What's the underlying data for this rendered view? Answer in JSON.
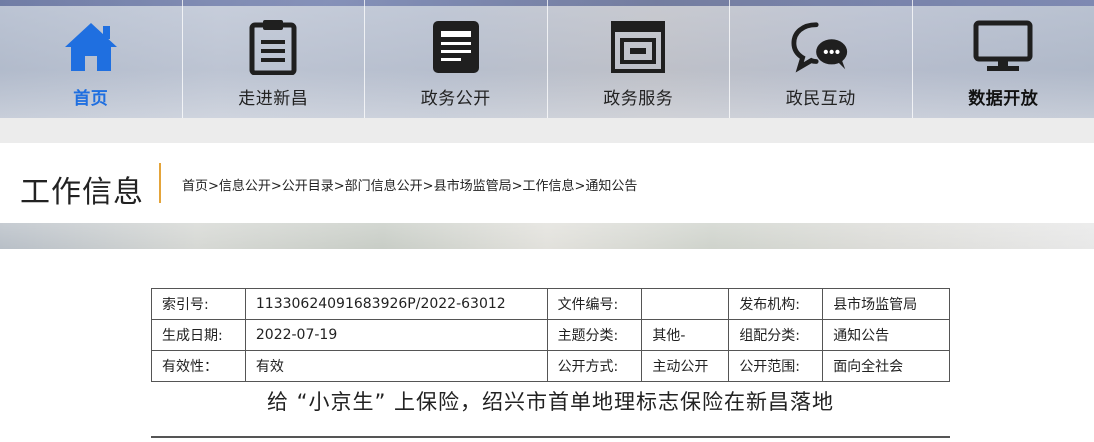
{
  "nav": {
    "items": [
      {
        "label": "首页",
        "icon": "home-icon",
        "active": true
      },
      {
        "label": "走进新昌",
        "icon": "clipboard-icon"
      },
      {
        "label": "政务公开",
        "icon": "document-icon"
      },
      {
        "label": "政务服务",
        "icon": "service-window-icon"
      },
      {
        "label": "政民互动",
        "icon": "chat-bubbles-icon"
      },
      {
        "label": "数据开放",
        "icon": "monitor-icon"
      }
    ],
    "active_color": "#1f6fe0",
    "icon_color": "#1f1f1f"
  },
  "header": {
    "title": "工作信息",
    "divider_color": "#e4a43a",
    "breadcrumb": "首页>信息公开>公开目录>部门信息公开>县市场监管局>工作信息>通知公告"
  },
  "meta": {
    "rows": [
      [
        "索引号:",
        "11330624091683926P/2022-63012",
        "文件编号:",
        "",
        "发布机构:",
        "县市场监管局"
      ],
      [
        "生成日期:",
        "2022-07-19",
        "主题分类:",
        "其他-",
        "组配分类:",
        "通知公告"
      ],
      [
        "有效性：",
        "有效",
        "公开方式:",
        "主动公开",
        "公开范围:",
        "面向全社会"
      ]
    ]
  },
  "article": {
    "title": "给 “小京生” 上保险，绍兴市首单地理标志保险在新昌落地"
  }
}
